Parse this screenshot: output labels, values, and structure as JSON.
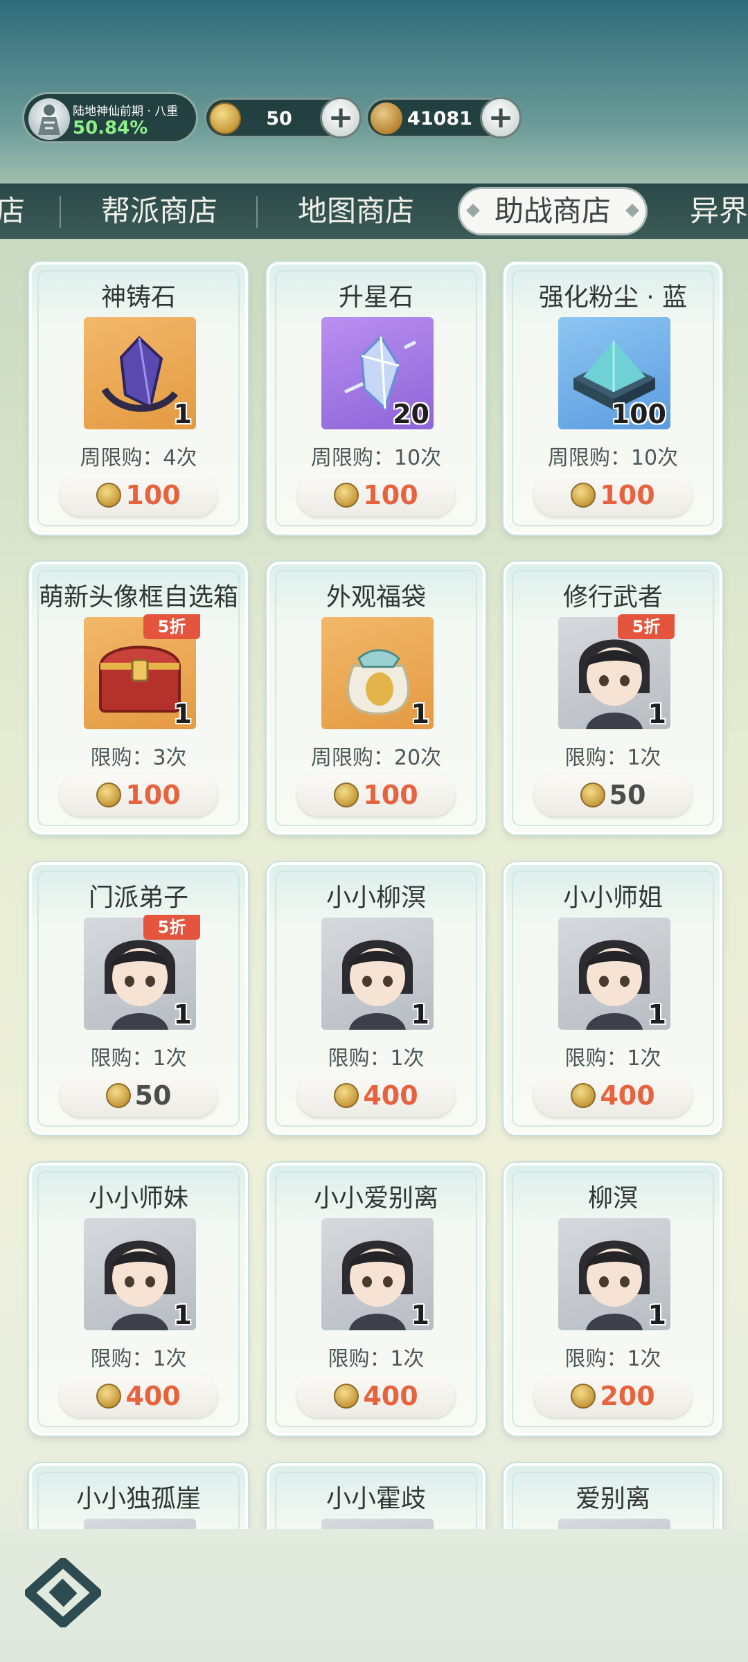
{
  "status": {
    "rank_title": "陆地神仙前期 · 八重",
    "rank_percent": "50.84%",
    "coins": "50",
    "jade": "41081"
  },
  "tabs": [
    {
      "label": "店"
    },
    {
      "label": "帮派商店"
    },
    {
      "label": "地图商店"
    },
    {
      "label": "助战商店",
      "active": true
    },
    {
      "label": "异界"
    }
  ],
  "items": [
    {
      "name": "神铸石",
      "qty": "1",
      "limit": "周限购：4次",
      "price": "100",
      "icon": "gem-shard",
      "bg": "orange"
    },
    {
      "name": "升星石",
      "qty": "20",
      "limit": "周限购：10次",
      "price": "100",
      "icon": "star-crystal",
      "bg": "purple"
    },
    {
      "name": "强化粉尘 · 蓝",
      "qty": "100",
      "limit": "周限购：10次",
      "price": "100",
      "icon": "dust-box",
      "bg": "blue"
    },
    {
      "name": "萌新头像框自选箱",
      "qty": "1",
      "limit": "限购：3次",
      "price": "100",
      "badge": "5折",
      "icon": "treasure-chest",
      "bg": "orange"
    },
    {
      "name": "外观福袋",
      "qty": "1",
      "limit": "周限购：20次",
      "price": "100",
      "icon": "lucky-bag",
      "bg": "orange"
    },
    {
      "name": "修行武者",
      "qty": "1",
      "limit": "限购：1次",
      "price": "50",
      "badge": "5折",
      "icon": "character-portrait",
      "bg": "gray",
      "price_gray": true
    },
    {
      "name": "门派弟子",
      "qty": "1",
      "limit": "限购：1次",
      "price": "50",
      "badge": "5折",
      "icon": "character-portrait",
      "bg": "gray",
      "price_gray": true
    },
    {
      "name": "小小柳溟",
      "qty": "1",
      "limit": "限购：1次",
      "price": "400",
      "icon": "character-portrait",
      "bg": "gray"
    },
    {
      "name": "小小师姐",
      "qty": "1",
      "limit": "限购：1次",
      "price": "400",
      "icon": "character-portrait",
      "bg": "gray"
    },
    {
      "name": "小小师妹",
      "qty": "1",
      "limit": "限购：1次",
      "price": "400",
      "icon": "character-portrait",
      "bg": "gray"
    },
    {
      "name": "小小爱别离",
      "qty": "1",
      "limit": "限购：1次",
      "price": "400",
      "icon": "character-portrait",
      "bg": "gray"
    },
    {
      "name": "柳溟",
      "qty": "1",
      "limit": "限购：1次",
      "price": "200",
      "icon": "character-portrait",
      "bg": "gray"
    },
    {
      "name": "小小独孤崖",
      "qty": "",
      "limit": "",
      "price": "",
      "icon": "character-portrait",
      "bg": "gray"
    },
    {
      "name": "小小霍歧",
      "qty": "",
      "limit": "",
      "price": "",
      "icon": "character-portrait",
      "bg": "gray"
    },
    {
      "name": "爱别离",
      "qty": "",
      "limit": "",
      "price": "",
      "icon": "character-portrait",
      "bg": "gray"
    }
  ],
  "colors": {
    "price_red": "#e7633f",
    "badge_red": "#e5543c",
    "rank_green": "#8ff08a"
  }
}
